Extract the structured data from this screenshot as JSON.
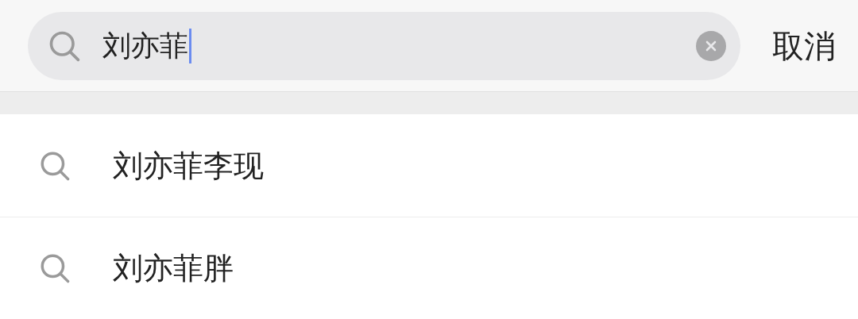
{
  "search": {
    "value": "刘亦菲"
  },
  "cancel_button": "取消",
  "suggestions": [
    {
      "text": "刘亦菲李现"
    },
    {
      "text": "刘亦菲胖"
    }
  ]
}
